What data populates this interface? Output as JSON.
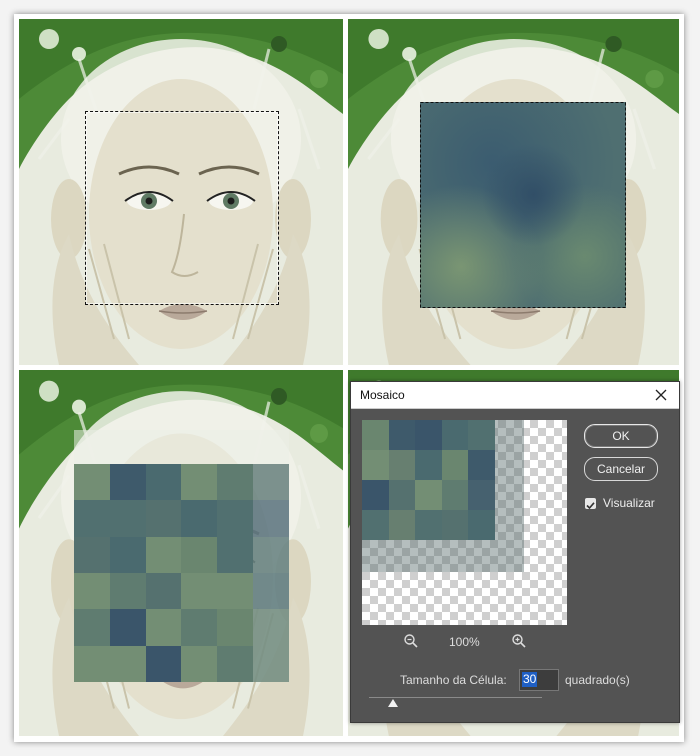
{
  "dialog": {
    "title": "Mosaico",
    "ok_label": "OK",
    "cancel_label": "Cancelar",
    "preview_checkbox_label": "Visualizar",
    "preview_checked": true,
    "zoom_level": "100%",
    "cell_size_label": "Tamanho da Célula:",
    "cell_size_value": "30",
    "cell_size_unit": "quadrado(s)",
    "slider_fraction": 0.12
  },
  "icons": {
    "close": "close-icon",
    "zoom_out": "zoom-out-icon",
    "zoom_in": "zoom-in-icon",
    "check": "checkmark-icon"
  },
  "colors": {
    "dialog_bg": "#535353",
    "mosaic_dark": "#3f5c6a",
    "mosaic_green": "#6f8a72",
    "foliage": "#4f8a3a",
    "skin": "#e7e4d3"
  }
}
